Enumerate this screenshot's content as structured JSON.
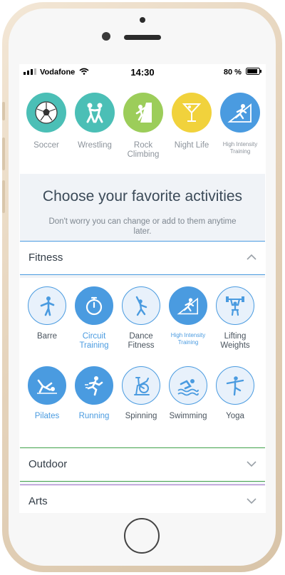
{
  "status_bar": {
    "carrier": "Vodafone",
    "time": "14:30",
    "battery": "80 %"
  },
  "top_activities": [
    {
      "label": "Soccer",
      "icon": "soccer-ball-icon",
      "color": "#4bbfb6"
    },
    {
      "label": "Wrestling",
      "icon": "wrestling-icon",
      "color": "#4bbfb6"
    },
    {
      "label": "Rock Climbing",
      "icon": "rock-climbing-icon",
      "color": "#9ccd5a"
    },
    {
      "label": "Night Life",
      "icon": "cocktail-icon",
      "color": "#f1d23c"
    },
    {
      "label": "High Intensity Training",
      "icon": "hiit-icon",
      "color": "#4a9be0"
    }
  ],
  "intro": {
    "heading": "Choose your favorite activities",
    "subtext": "Don't worry you can change or add to them anytime later."
  },
  "sections": {
    "fitness": {
      "title": "Fitness",
      "items": [
        {
          "label": "Barre",
          "icon": "barre-icon",
          "selected": false
        },
        {
          "label": "Circuit Training",
          "icon": "stopwatch-icon",
          "selected": true
        },
        {
          "label": "Dance Fitness",
          "icon": "dance-icon",
          "selected": false
        },
        {
          "label": "High Intensity Training",
          "icon": "hiit-icon",
          "selected": true
        },
        {
          "label": "Lifting Weights",
          "icon": "weightlifting-icon",
          "selected": false
        },
        {
          "label": "Pilates",
          "icon": "pilates-icon",
          "selected": true
        },
        {
          "label": "Running",
          "icon": "running-icon",
          "selected": true
        },
        {
          "label": "Spinning",
          "icon": "spinning-bike-icon",
          "selected": false
        },
        {
          "label": "Swimming",
          "icon": "swimming-icon",
          "selected": false
        },
        {
          "label": "Yoga",
          "icon": "yoga-icon",
          "selected": false
        }
      ]
    },
    "outdoor": {
      "title": "Outdoor"
    },
    "arts": {
      "title": "Arts"
    }
  },
  "colors": {
    "accent": "#4a9be0",
    "teal": "#4bbfb6",
    "green": "#9ccd5a",
    "yellow": "#f1d23c",
    "outdoor_line": "#3fa14a",
    "arts_line": "#9b6cc4"
  }
}
